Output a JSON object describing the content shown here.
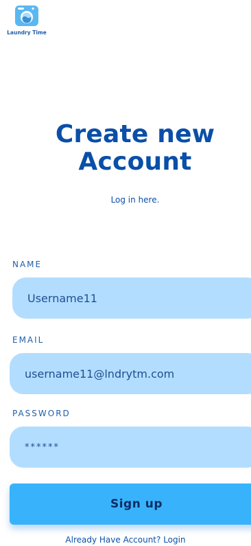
{
  "logo": {
    "text": "Laundry Time"
  },
  "header": {
    "title_line1": "Create new",
    "title_line2": "Account",
    "login_hint": "Log in here."
  },
  "form": {
    "name_label": "NAME",
    "name_value": "Username11",
    "email_label": "EMAIL",
    "email_value": "username11@lndrytm.com",
    "password_label": "PASSWORD",
    "password_value": "******"
  },
  "actions": {
    "signup_label": "Sign up",
    "login_link": "Already Have Account? Login"
  },
  "colors": {
    "primary_text": "#0a4fa8",
    "field_bg": "#b3ddff",
    "button_bg": "#38b3fb",
    "button_text": "#0b2d66"
  }
}
